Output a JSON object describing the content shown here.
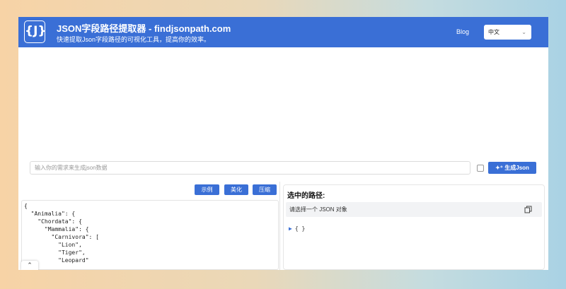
{
  "header": {
    "logo_text": "{J}",
    "title": "JSON字段路径提取器 - findjsonpath.com",
    "subtitle": "快速提取Json字段路径的可视化工具，提高你的效率。",
    "blog_label": "Blog",
    "language": "中文"
  },
  "prompt": {
    "placeholder": "输入你的需求来生成json数据",
    "generate_label": "生成Json"
  },
  "toolbar": {
    "example_label": "示例",
    "beautify_label": "美化",
    "compress_label": "压缩"
  },
  "editor": {
    "lines": [
      "{",
      "  \"Animalia\": {",
      "    \"Chordata\": {",
      "      \"Mammalia\": {",
      "        \"Carnivora\": [",
      "          \"Lion\",",
      "          \"Tiger\",",
      "          \"Leopard\""
    ]
  },
  "path_panel": {
    "title": "选中的路径:",
    "placeholder": "请选择一个 JSON 对象",
    "tree_root": "{ }"
  },
  "colors": {
    "accent": "#3a6fd6"
  }
}
